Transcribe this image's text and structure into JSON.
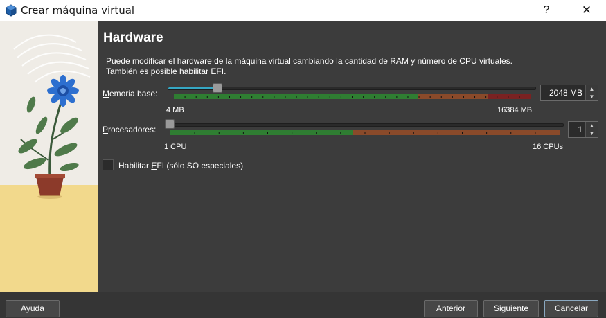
{
  "window": {
    "title": "Crear máquina virtual",
    "help_glyph": "?",
    "close_glyph": "✕"
  },
  "page": {
    "heading": "Hardware",
    "description_line1": "Puede modificar el hardware de la máquina virtual cambiando la cantidad de RAM y número de CPU virtuales.",
    "description_line2": "También es posible habilitar EFI."
  },
  "memory": {
    "label_mnemonic": "M",
    "label_rest": "emoria base:",
    "value": "2048 MB",
    "value_mb": 2048,
    "min_label": "4 MB",
    "max_label": "16384 MB",
    "min_mb": 4,
    "max_mb": 16384
  },
  "processors": {
    "label_mnemonic": "P",
    "label_rest": "rocesadores:",
    "value": "1",
    "value_count": 1,
    "min_label": "1 CPU",
    "max_label": "16 CPUs",
    "min": 1,
    "max": 16
  },
  "efi": {
    "label_before": "Habilitar ",
    "label_mnemonic": "E",
    "label_after": "FI (sólo SO especiales)",
    "checked": false
  },
  "buttons": {
    "help": "Ayuda",
    "back": "Anterior",
    "next": "Siguiente",
    "cancel": "Cancelar"
  },
  "colors": {
    "scale_green": "#2f7d32",
    "scale_orange": "#8a4a2a",
    "scale_red": "#7a2222",
    "slider_accent": "#35a7c4",
    "background": "#3c3c3c"
  },
  "icons": {
    "app": "virtualbox-cube-icon",
    "spin_up": "arrow-up-icon",
    "spin_down": "arrow-down-icon"
  }
}
